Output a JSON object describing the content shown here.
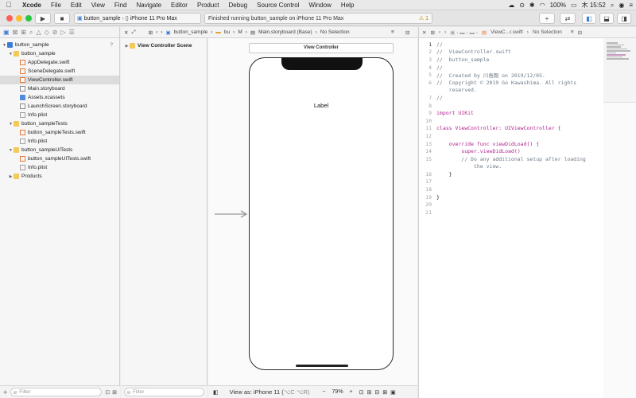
{
  "menubar": {
    "app": "Xcode",
    "items": [
      "File",
      "Edit",
      "View",
      "Find",
      "Navigate",
      "Editor",
      "Product",
      "Debug",
      "Source Control",
      "Window",
      "Help"
    ],
    "battery": "100%",
    "clock": "木 15:52"
  },
  "toolbar": {
    "scheme": "button_sample",
    "device": "iPhone 11 Pro Max",
    "status": "Finished running button_sample on iPhone 11 Pro Max",
    "warning_count": "1",
    "colors": {
      "close": "#fe5f57",
      "minimize": "#febc2e",
      "zoom": "#28c840"
    }
  },
  "navigator": {
    "items": [
      {
        "label": "button_sample",
        "kind": "project",
        "level": 0,
        "open": true,
        "mark": "?"
      },
      {
        "label": "button_sample",
        "kind": "folder",
        "level": 1,
        "open": true
      },
      {
        "label": "AppDelegate.swift",
        "kind": "swift",
        "level": 2
      },
      {
        "label": "SceneDelegate.swift",
        "kind": "swift",
        "level": 2
      },
      {
        "label": "ViewController.swift",
        "kind": "swift",
        "level": 2,
        "selected": true
      },
      {
        "label": "Main.storyboard",
        "kind": "storyboard",
        "level": 2
      },
      {
        "label": "Assets.xcassets",
        "kind": "assets",
        "level": 2
      },
      {
        "label": "LaunchScreen.storyboard",
        "kind": "storyboard",
        "level": 2
      },
      {
        "label": "Info.plist",
        "kind": "plist",
        "level": 2
      },
      {
        "label": "button_sampleTests",
        "kind": "folder",
        "level": 1,
        "open": true
      },
      {
        "label": "button_sampleTests.swift",
        "kind": "swift",
        "level": 2
      },
      {
        "label": "Info.plist",
        "kind": "plist",
        "level": 2
      },
      {
        "label": "button_sampleUITests",
        "kind": "folder",
        "level": 1,
        "open": true
      },
      {
        "label": "button_sampleUITests.swift",
        "kind": "swift",
        "level": 2
      },
      {
        "label": "Info.plist",
        "kind": "plist",
        "level": 2
      },
      {
        "label": "Products",
        "kind": "folder",
        "level": 1,
        "open": false
      }
    ],
    "filter_placeholder": "Filter"
  },
  "ib": {
    "path": [
      "button_sample",
      "bu",
      "M",
      "Main.storyboard (Base)",
      "No Selection"
    ],
    "outline_item": "View Controller Scene",
    "outline_filter": "Filter",
    "scene_title": "View Controller",
    "label_text": "Label",
    "view_as": "View as: iPhone 11 (",
    "view_as_shortcut": "⌥C ⌥R)",
    "zoom": "79%"
  },
  "editor": {
    "path": [
      "ViewC...r.swift",
      "No Selection"
    ],
    "lines": [
      "//",
      "//  ViewController.swift",
      "//  button_sample",
      "//",
      "//  Created by 川島剛 on 2019/12/05.",
      "//  Copyright © 2019 Go Kawashima. All rights",
      "    reserved.",
      "//",
      "",
      "import UIKit",
      "",
      "class ViewController: UIViewController {",
      "",
      "    override func viewDidLoad() {",
      "        super.viewDidLoad()",
      "        // Do any additional setup after loading",
      "            the view.",
      "    }",
      "",
      "",
      "}",
      "",
      ""
    ],
    "line_numbers": [
      "1",
      "2",
      "3",
      "4",
      "5",
      "6",
      "",
      "7",
      "8",
      "9",
      "10",
      "11",
      "12",
      "13",
      "14",
      "15",
      "",
      "16",
      "17",
      "18",
      "19",
      "20",
      "21"
    ]
  }
}
